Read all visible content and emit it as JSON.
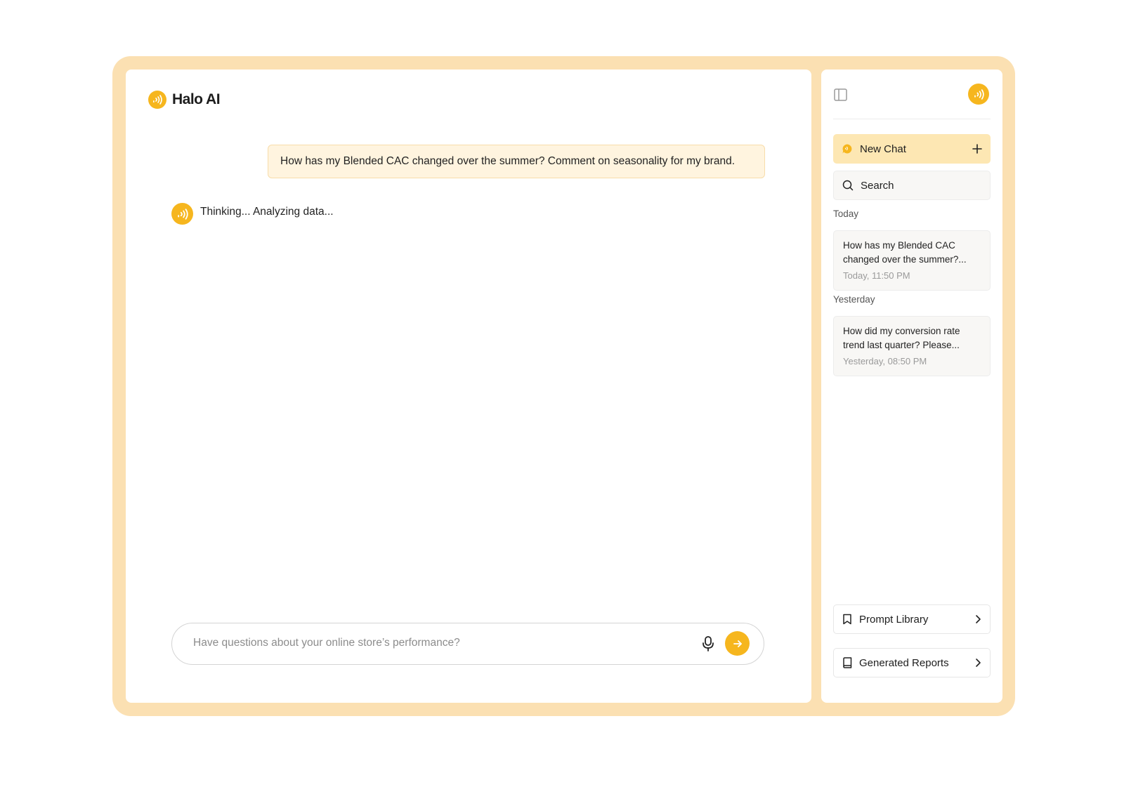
{
  "app": {
    "name": "Halo AI",
    "accent_color": "#f6b61e",
    "frame_color": "#fbe0b2"
  },
  "chat": {
    "user_message": "How has my Blended CAC changed over the summer? Comment on seasonality for my brand.",
    "ai_status": "Thinking... Analyzing data...",
    "input_placeholder": "Have questions about your online store’s performance?"
  },
  "sidebar": {
    "new_chat_label": "New Chat",
    "search_label": "Search",
    "groups": [
      {
        "label": "Today",
        "items": [
          {
            "title": "How has my Blended CAC changed over the summer?...",
            "time": "Today, 11:50 PM"
          }
        ]
      },
      {
        "label": "Yesterday",
        "items": [
          {
            "title": "How did my conversion rate trend last quarter? Please...",
            "time": "Yesterday, 08:50 PM"
          }
        ]
      }
    ],
    "links": [
      {
        "label": "Prompt Library",
        "icon": "bookmark-icon"
      },
      {
        "label": "Generated Reports",
        "icon": "book-icon"
      }
    ]
  }
}
